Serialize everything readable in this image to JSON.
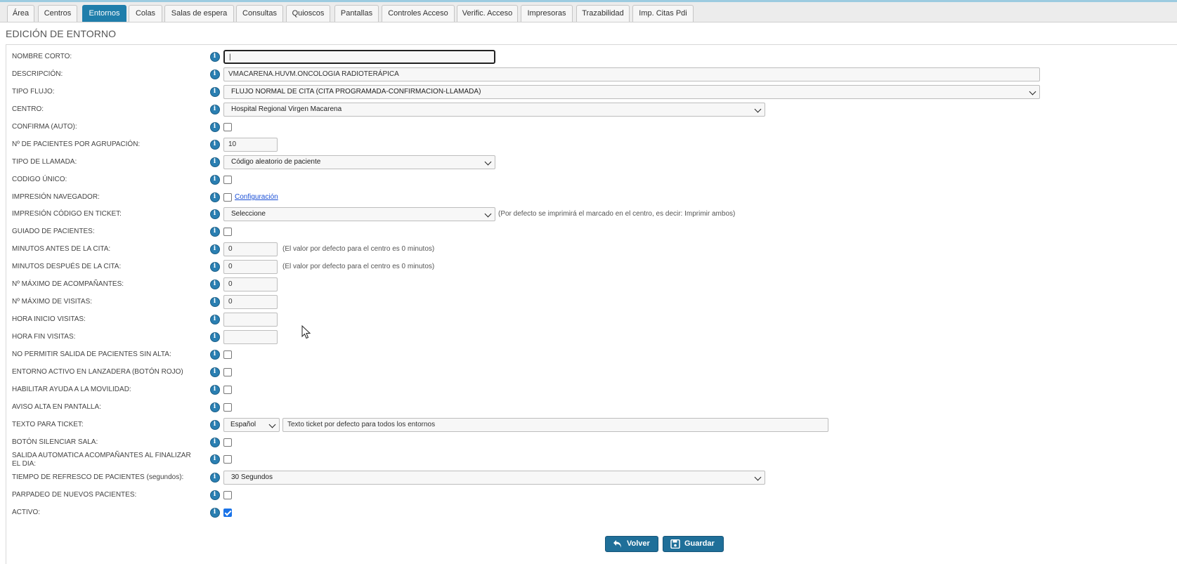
{
  "tabs": [
    {
      "id": "area",
      "label": "Área",
      "active": false
    },
    {
      "id": "centros",
      "label": "Centros",
      "active": false
    },
    {
      "id": "entornos",
      "label": "Entornos",
      "active": true
    },
    {
      "id": "colas",
      "label": "Colas",
      "active": false
    },
    {
      "id": "salas",
      "label": "Salas de espera",
      "active": false
    },
    {
      "id": "consultas",
      "label": "Consultas",
      "active": false
    },
    {
      "id": "quioscos",
      "label": "Quioscos",
      "active": false
    },
    {
      "id": "pantallas",
      "label": "Pantallas",
      "active": false
    },
    {
      "id": "controles",
      "label": "Controles Acceso",
      "active": false
    },
    {
      "id": "verific",
      "label": "Verific. Acceso",
      "active": false
    },
    {
      "id": "impresoras",
      "label": "Impresoras",
      "active": false
    },
    {
      "id": "trazabilidad",
      "label": "Trazabilidad",
      "active": false
    },
    {
      "id": "impcitas",
      "label": "Imp. Citas Pdi",
      "active": false
    }
  ],
  "page_title": "EDICIÓN DE ENTORNO",
  "fields": {
    "nombre_corto": {
      "label": "NOMBRE CORTO:",
      "value": "|"
    },
    "descripcion": {
      "label": "DESCRIPCIÓN:",
      "value": "VMACARENA.HUVM.ONCOLOGIA RADIOTERÁPICA"
    },
    "tipo_flujo": {
      "label": "TIPO FLUJO:",
      "value": "FLUJO NORMAL DE CITA (CITA PROGRAMADA-CONFIRMACION-LLAMADA)"
    },
    "centro": {
      "label": "CENTRO:",
      "value": "Hospital Regional Virgen Macarena"
    },
    "confirma_auto": {
      "label": "CONFIRMA (AUTO):",
      "checked": false
    },
    "pacientes_agrupacion": {
      "label": "Nº DE PACIENTES POR AGRUPACIÓN:",
      "value": "10"
    },
    "tipo_llamada": {
      "label": "TIPO DE LLAMADA:",
      "value": "Código aleatorio de paciente"
    },
    "codigo_unico": {
      "label": "CODIGO ÚNICO:",
      "checked": false
    },
    "impresion_navegador": {
      "label": "IMPRESIÓN NAVEGADOR:",
      "checked": false,
      "link": "Configuración"
    },
    "impresion_codigo": {
      "label": "IMPRESIÓN CÓDIGO EN TICKET:",
      "value": "Seleccione",
      "hint": "(Por defecto se imprimirá el marcado en el centro, es decir: Imprimir ambos)"
    },
    "guiado_pacientes": {
      "label": "GUIADO DE PACIENTES:",
      "checked": false
    },
    "minutos_antes": {
      "label": "MINUTOS ANTES DE LA CITA:",
      "value": "0",
      "hint": "(El valor por defecto para el centro es 0 minutos)"
    },
    "minutos_despues": {
      "label": "MINUTOS DESPUÉS DE LA CITA:",
      "value": "0",
      "hint": "(El valor por defecto para el centro es 0 minutos)"
    },
    "max_acompanantes": {
      "label": "Nº MÁXIMO DE ACOMPAÑANTES:",
      "value": "0"
    },
    "max_visitas": {
      "label": "Nº MÁXIMO DE VISITAS:",
      "value": "0"
    },
    "hora_inicio": {
      "label": "HORA INICIO VISITAS:",
      "value": ""
    },
    "hora_fin": {
      "label": "HORA FIN VISITAS:",
      "value": ""
    },
    "no_salida": {
      "label": "NO PERMITIR SALIDA DE PACIENTES SIN ALTA:",
      "checked": false
    },
    "entorno_activo": {
      "label": "ENTORNO ACTIVO EN LANZADERA (BOTÓN ROJO)",
      "checked": false
    },
    "ayuda_movilidad": {
      "label": "HABILITAR AYUDA A LA MOVILIDAD:",
      "checked": false
    },
    "aviso_alta": {
      "label": "AVISO ALTA EN PANTALLA:",
      "checked": false
    },
    "texto_ticket": {
      "label": "TEXTO PARA TICKET:",
      "language": "Español",
      "value": "Texto ticket por defecto para todos los entornos"
    },
    "boton_silenciar": {
      "label": "BOTÓN SILENCIAR SALA:",
      "checked": false
    },
    "salida_automatica": {
      "label_line1": "SALIDA AUTOMATICA ACOMPAÑANTES AL FINALIZAR",
      "label_line2": "EL DIA:",
      "checked": false
    },
    "tiempo_refresco": {
      "label": "TIEMPO DE REFRESCO DE PACIENTES (segundos):",
      "value": "30 Segundos"
    },
    "parpadeo": {
      "label": "PARPADEO DE NUEVOS PACIENTES:",
      "checked": false
    },
    "activo": {
      "label": "ACTIVO:",
      "checked": true
    }
  },
  "buttons": {
    "volver": "Volver",
    "guardar": "Guardar"
  },
  "colors": {
    "accent": "#1f7eab",
    "button": "#1f6f99",
    "info_icon": "#2a7fb2"
  }
}
